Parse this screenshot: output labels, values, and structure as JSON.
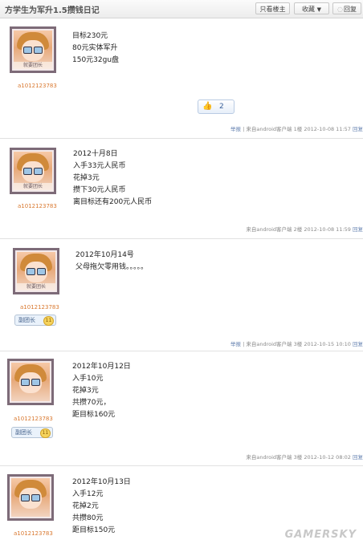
{
  "header": {
    "title": "方学生为军升1.5攒钱日记",
    "only_author_label": "只看楼主",
    "favorite_label": "收藏",
    "reply_label": "回复"
  },
  "posts": [
    {
      "avatar_caption": "就要团长",
      "username": "a1012123783",
      "badge": "",
      "lines": [
        "目标230元",
        "80元实体军升",
        "150元32gu盘"
      ],
      "likes": "2",
      "meta": {
        "action": "举报",
        "source": "来自android客户端",
        "floor": "1楼",
        "time": "2012-10-08 11:57",
        "reply": "回复"
      }
    },
    {
      "avatar_caption": "就要团长",
      "username": "a1012123783",
      "badge": "",
      "lines": [
        "2012十月8日",
        "入手33元人民币",
        "花掉3元",
        "攒下30元人民币",
        "离目标还有200元人民币"
      ],
      "meta": {
        "source": "来自android客户端",
        "floor": "2楼",
        "time": "2012-10-08 11:59",
        "reply": "回复"
      }
    },
    {
      "avatar_caption": "就要团长",
      "username": "a1012123783",
      "badge": "副团长",
      "lines": [
        "2012年10月14号",
        "父母拖欠零用钱。。。。。"
      ],
      "meta": {
        "action": "举报",
        "source": "来自android客户端",
        "floor": "3楼",
        "time": "2012-10-15 10:10",
        "reply": "回复"
      }
    },
    {
      "avatar_caption": "",
      "username": "a1012123783",
      "badge": "副团长",
      "lines": [
        "2012年10月12日",
        "入手10元",
        "花掉3元",
        "共攒70元，",
        "距目标160元"
      ],
      "meta": {
        "source": "来自android客户端",
        "floor": "3楼",
        "time": "2012-10-12 08:02",
        "reply": "回复"
      }
    },
    {
      "avatar_caption": "",
      "username": "a1012123783",
      "badge": "",
      "lines": [
        "2012年10月13日",
        "入手12元",
        "花掉2元",
        "共攒80元",
        "距目标150元"
      ]
    }
  ],
  "watermark": "GAMERSKY"
}
